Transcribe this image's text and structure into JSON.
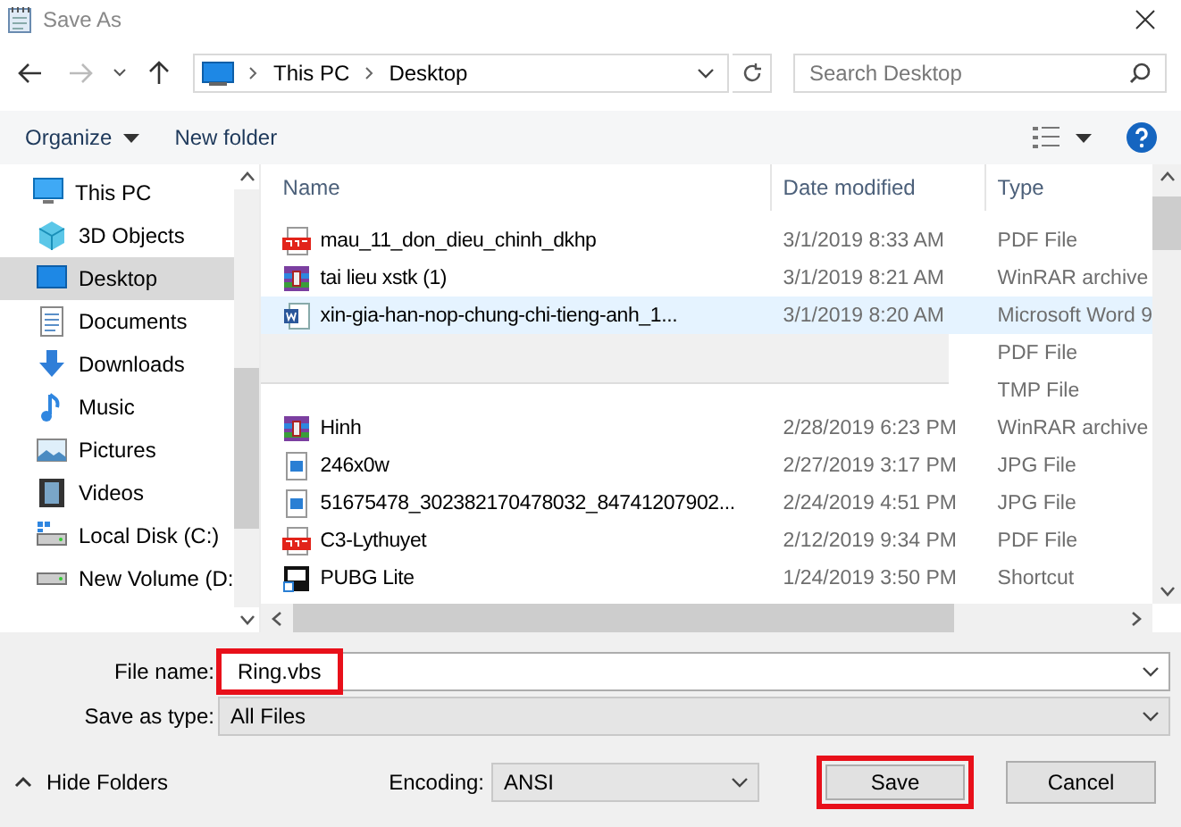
{
  "window": {
    "title": "Save As"
  },
  "address": {
    "path": [
      "This PC",
      "Desktop"
    ]
  },
  "search": {
    "placeholder": "Search Desktop"
  },
  "toolbar": {
    "organize": "Organize",
    "new_folder": "New folder"
  },
  "sidebar": {
    "items": [
      {
        "label": "This PC",
        "kind": "pc",
        "selected": false
      },
      {
        "label": "3D Objects",
        "kind": "cube",
        "selected": false
      },
      {
        "label": "Desktop",
        "kind": "desktop",
        "selected": true
      },
      {
        "label": "Documents",
        "kind": "documents",
        "selected": false
      },
      {
        "label": "Downloads",
        "kind": "downloads",
        "selected": false
      },
      {
        "label": "Music",
        "kind": "music",
        "selected": false
      },
      {
        "label": "Pictures",
        "kind": "pictures",
        "selected": false
      },
      {
        "label": "Videos",
        "kind": "videos",
        "selected": false
      },
      {
        "label": "Local Disk (C:)",
        "kind": "disk",
        "selected": false
      },
      {
        "label": "New Volume (D:",
        "kind": "drive",
        "selected": false
      }
    ]
  },
  "table": {
    "columns": [
      "Name",
      "Date modified",
      "Type"
    ],
    "rows": [
      {
        "kind": "pdf",
        "name": "mau_11_don_dieu_chinh_dkhp",
        "date": "3/1/2019 8:33 AM",
        "type": "PDF File",
        "selected": false
      },
      {
        "kind": "rar",
        "name": "tai lieu xstk (1)",
        "date": "3/1/2019 8:21 AM",
        "type": "WinRAR archive",
        "selected": false
      },
      {
        "kind": "word",
        "name": "xin-gia-han-nop-chung-chi-tieng-anh_1...",
        "date": "3/1/2019 8:20 AM",
        "type": "Microsoft Word 9",
        "selected": true
      },
      {
        "kind": "hidden",
        "type": "PDF File",
        "selected": false
      },
      {
        "kind": "hidden",
        "type": "TMP File",
        "selected": false
      },
      {
        "kind": "rar",
        "name": "Hinh",
        "date": "2/28/2019 6:23 PM",
        "type": "WinRAR archive",
        "selected": false
      },
      {
        "kind": "jpg",
        "name": "246x0w",
        "date": "2/27/2019 3:17 PM",
        "type": "JPG File",
        "selected": false
      },
      {
        "kind": "jpg",
        "name": "51675478_302382170478032_84741207902...",
        "date": "2/24/2019 4:51 PM",
        "type": "JPG File",
        "selected": false
      },
      {
        "kind": "pdf",
        "name": "C3-Lythuyet",
        "date": "2/12/2019 9:34 PM",
        "type": "PDF File",
        "selected": false
      },
      {
        "kind": "shortcut",
        "name": "PUBG Lite",
        "date": "1/24/2019 3:50 PM",
        "type": "Shortcut",
        "selected": false
      }
    ]
  },
  "form": {
    "file_name": {
      "label": "File name:",
      "value": "Ring.vbs",
      "highlighted": true
    },
    "save_as_type": {
      "label": "Save as type:",
      "value": "All Files"
    }
  },
  "footer": {
    "hide_folders": "Hide Folders",
    "encoding_label": "Encoding:",
    "encoding": "ANSI",
    "buttons": [
      {
        "label": "Save",
        "highlighted": true
      },
      {
        "label": "Cancel",
        "highlighted": false
      }
    ]
  }
}
